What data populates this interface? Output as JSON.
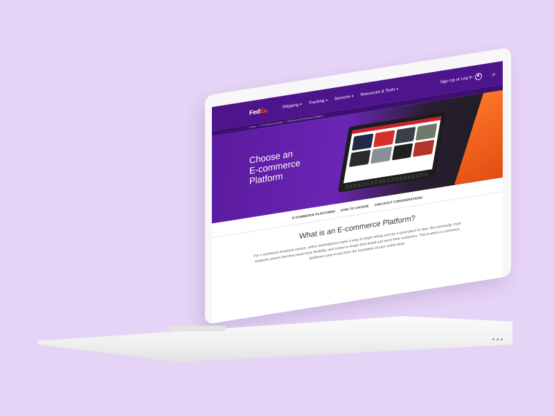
{
  "nav": {
    "logo_fed": "Fed",
    "logo_ex": "Ex.",
    "items": [
      {
        "label": "Shipping"
      },
      {
        "label": "Tracking"
      },
      {
        "label": "Services"
      },
      {
        "label": "Resources & Tools"
      }
    ],
    "account_label": "Sign Up or Log In"
  },
  "breadcrumb": [
    "Home",
    "E-commerce Center",
    "Choose an E-commerce Platform"
  ],
  "hero": {
    "title_line1": "Choose an",
    "title_line2": "E-commerce",
    "title_line3": "Platform"
  },
  "subnav": {
    "links": [
      {
        "label": "E-COMMERCE PLATFORMS"
      },
      {
        "label": "HOW TO CHOOSE"
      },
      {
        "label": "CHECKOUT CONSIDERATIONS"
      }
    ]
  },
  "content": {
    "heading": "What is an E-commerce Platform?",
    "body": "For e-commerce business owners, online marketplaces make it easy to begin selling and are a good place to start. But eventually, most business owners find they need more flexibility and control to shape their brand and serve their customers. This is where e-commerce platforms come in and form the foundation of your online store."
  },
  "colors": {
    "background": "#e6d4f6",
    "brand_purple": "#4d148c",
    "brand_orange": "#ff6200"
  }
}
